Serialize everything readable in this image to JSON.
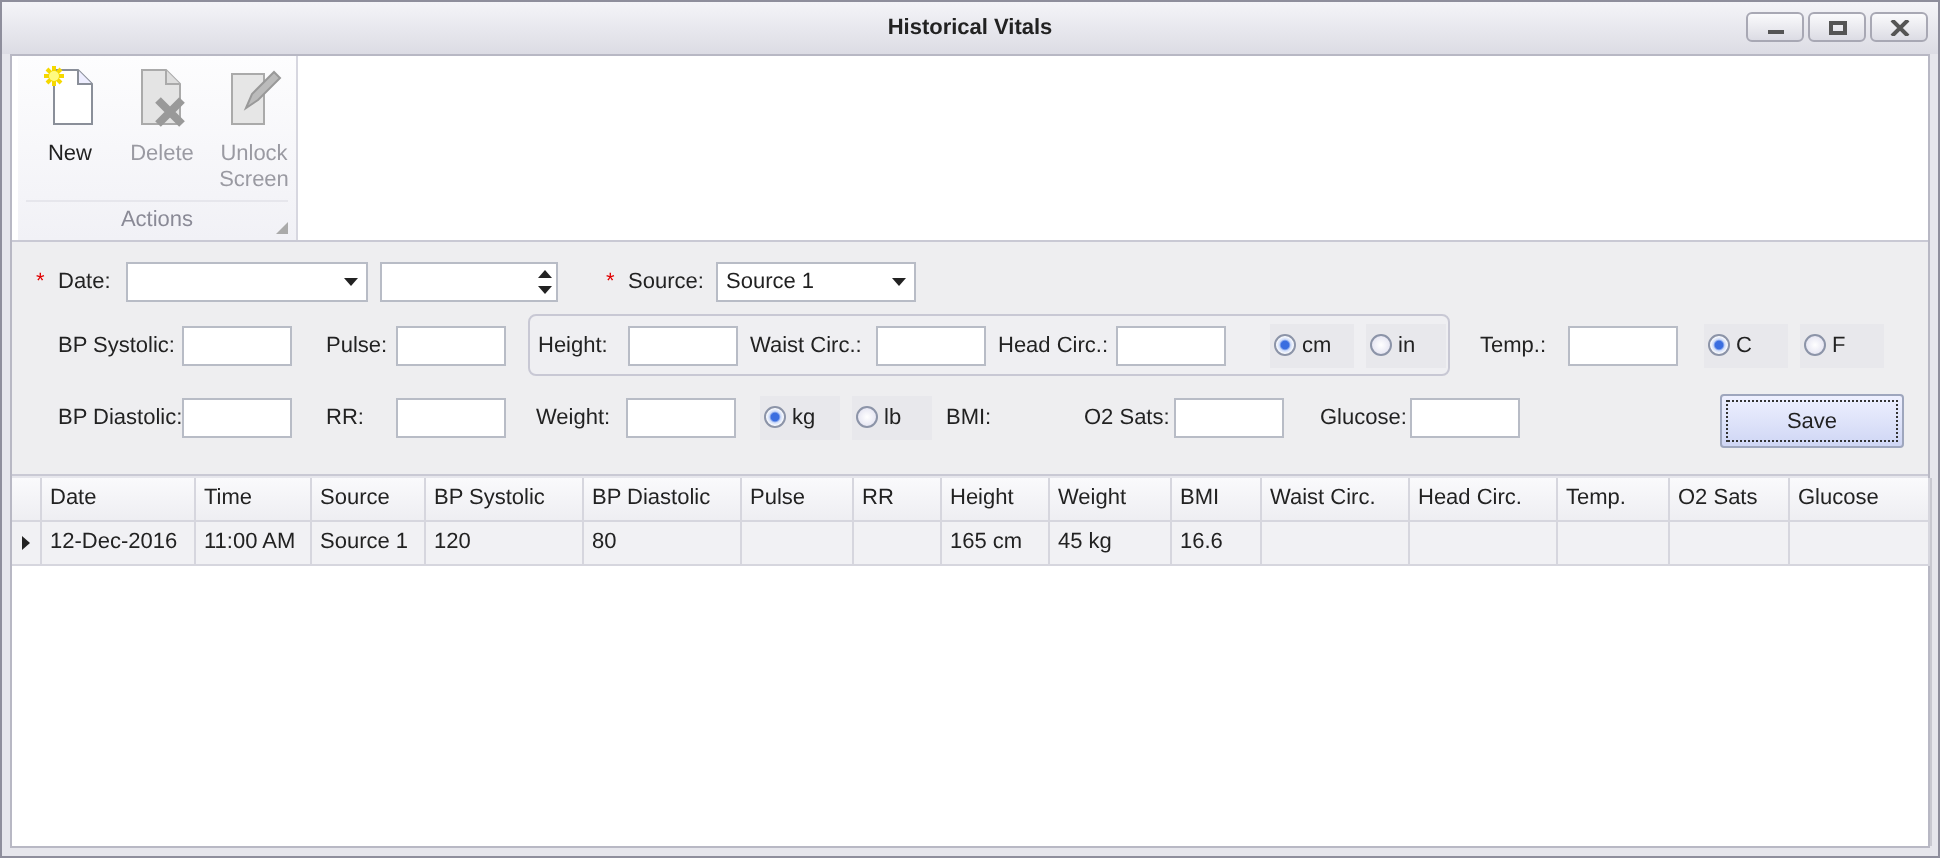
{
  "window": {
    "title": "Historical Vitals"
  },
  "ribbon": {
    "groups": [
      {
        "label": "Actions",
        "buttons": [
          {
            "kind": "new",
            "label": "New",
            "disabled": false
          },
          {
            "kind": "delete",
            "label": "Delete",
            "disabled": true
          },
          {
            "kind": "unlock",
            "label": "Unlock Screen",
            "disabled": true
          }
        ]
      }
    ]
  },
  "form": {
    "date": {
      "label": "Date:",
      "required_mark": "*"
    },
    "source": {
      "label": "Source:",
      "required_mark": "*",
      "value": "Source 1"
    },
    "bp_systolic": {
      "label": "BP Systolic:"
    },
    "pulse": {
      "label": "Pulse:"
    },
    "height": {
      "label": "Height:"
    },
    "waist_circ": {
      "label": "Waist Circ.:"
    },
    "head_circ": {
      "label": "Head Circ.:"
    },
    "length_unit": [
      {
        "label": "cm",
        "selected": true
      },
      {
        "label": "in",
        "selected": false
      }
    ],
    "temp": {
      "label": "Temp.:"
    },
    "temp_unit": [
      {
        "label": "C",
        "selected": true
      },
      {
        "label": "F",
        "selected": false
      }
    ],
    "bp_diastolic": {
      "label": "BP Diastolic:"
    },
    "rr": {
      "label": "RR:"
    },
    "weight": {
      "label": "Weight:"
    },
    "weight_unit": [
      {
        "label": "kg",
        "selected": true
      },
      {
        "label": "lb",
        "selected": false
      }
    ],
    "bmi": {
      "label": "BMI:"
    },
    "o2_sats": {
      "label": "O2 Sats:"
    },
    "glucose": {
      "label": "Glucose:"
    },
    "save_button": "Save"
  },
  "table": {
    "columns": [
      "Date",
      "Time",
      "Source",
      "BP Systolic",
      "BP Diastolic",
      "Pulse",
      "RR",
      "Height",
      "Weight",
      "BMI",
      "Waist Circ.",
      "Head Circ.",
      "Temp.",
      "O2 Sats",
      "Glucose"
    ],
    "rows": [
      {
        "current": true,
        "cells": [
          "12-Dec-2016",
          "11:00 AM",
          "Source 1",
          "120",
          "80",
          "",
          "",
          "165 cm",
          "45 kg",
          "16.6",
          "",
          "",
          "",
          "",
          ""
        ]
      }
    ]
  }
}
